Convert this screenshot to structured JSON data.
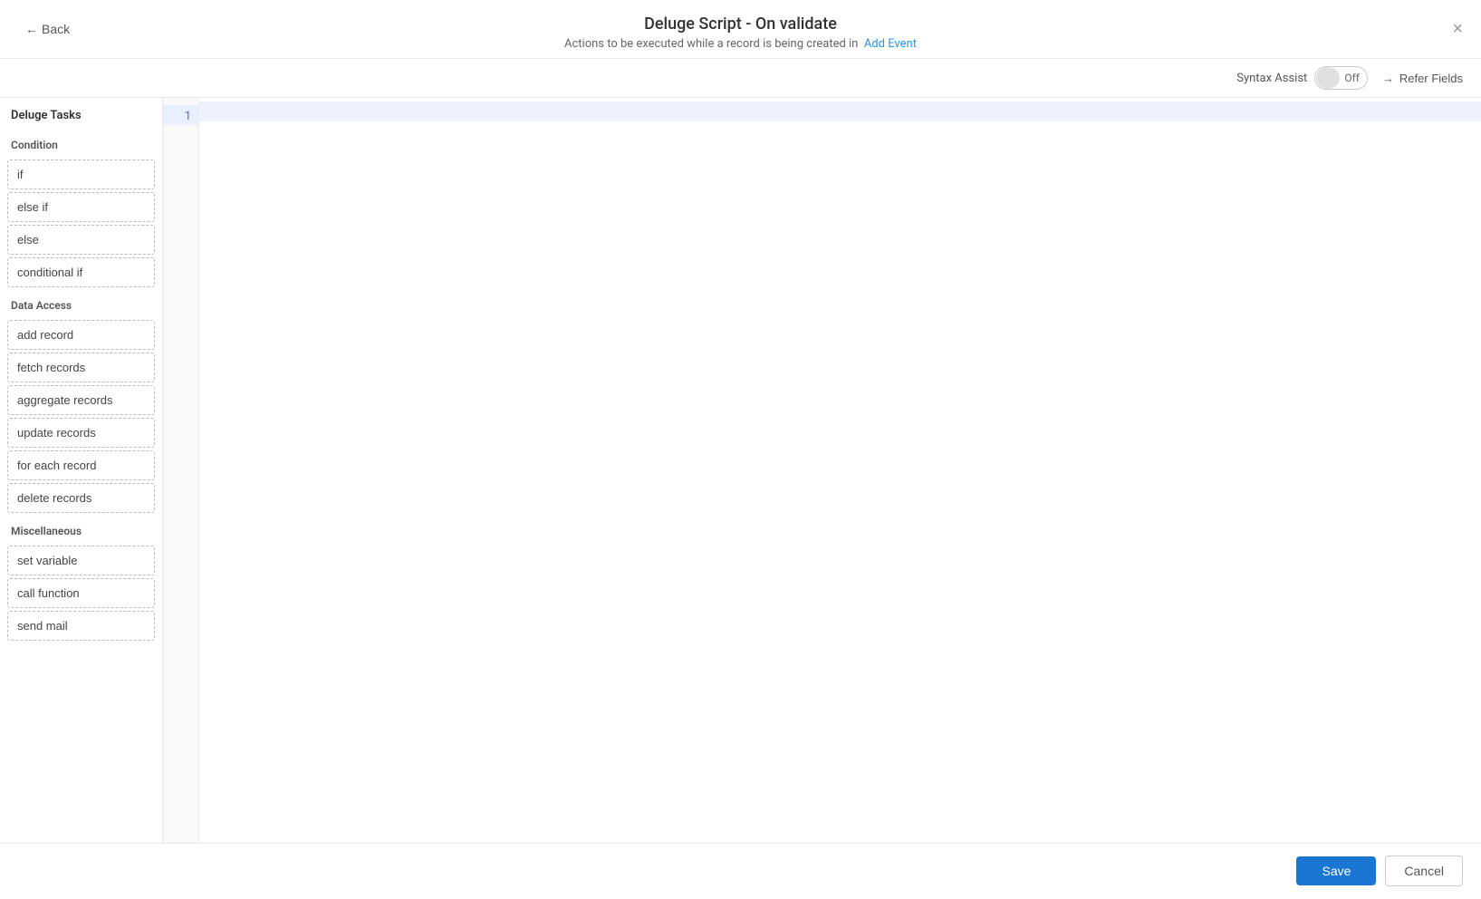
{
  "header": {
    "title": "Deluge Script - On validate",
    "subtitle_prefix": "Actions to be executed while a record is being created in",
    "subtitle_link": "Add Event",
    "back_label": "Back",
    "close_icon": "×"
  },
  "toolbar": {
    "syntax_assist_label": "Syntax Assist",
    "toggle_state": "Off",
    "refer_fields_label": "Refer Fields"
  },
  "sidebar": {
    "title": "Deluge Tasks",
    "sections": [
      {
        "label": "Condition",
        "items": [
          "if",
          "else if",
          "else",
          "conditional if"
        ]
      },
      {
        "label": "Data Access",
        "items": [
          "add record",
          "fetch records",
          "aggregate records",
          "update records",
          "for each record",
          "delete records"
        ]
      },
      {
        "label": "Miscellaneous",
        "items": [
          "set variable",
          "call function",
          "send mail"
        ]
      }
    ]
  },
  "editor": {
    "lines": [
      1
    ]
  },
  "footer": {
    "save_label": "Save",
    "cancel_label": "Cancel"
  }
}
